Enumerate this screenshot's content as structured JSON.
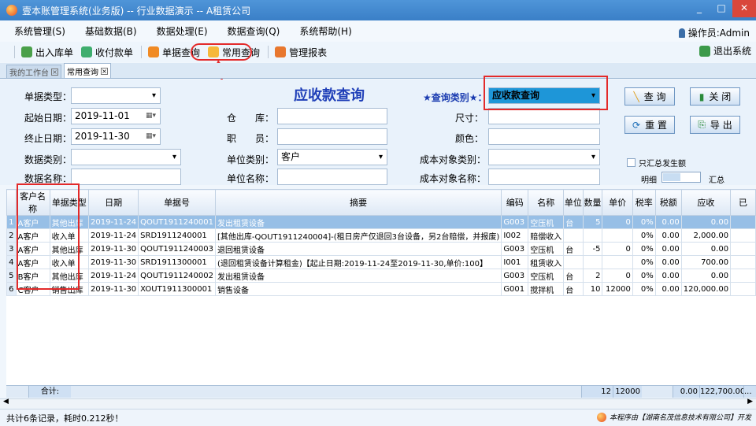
{
  "window": {
    "title": "壹本账管理系统(业务版) -- 行业数据演示 -- A租赁公司",
    "min": "_",
    "max": "□",
    "close": "✕"
  },
  "menu": [
    "系统管理(S)",
    "基础数据(B)",
    "数据处理(E)",
    "数据查询(Q)",
    "系统帮助(H)"
  ],
  "operator": "操作员:Admin",
  "toolbar": {
    "items": [
      "出入库单",
      "收付款单",
      "单据查询",
      "常用查询",
      "管理报表"
    ],
    "exit": "退出系统"
  },
  "tabs": [
    "我的工作台",
    "常用查询"
  ],
  "form": {
    "title": "应收款查询",
    "doc_type_label": "单据类型：",
    "doc_type_value": "",
    "start_label": "起始日期：",
    "start_value": "2019-11-01",
    "end_label": "终止日期：",
    "end_value": "2019-11-30",
    "data_type_label": "数据类别：",
    "data_type_value": "",
    "data_name_label": "数据名称：",
    "data_name_value": "",
    "warehouse_label": "仓　　库：",
    "warehouse_value": "",
    "staff_label": "职　　员：",
    "staff_value": "",
    "unit_type_label": "单位类别：",
    "unit_type_value": "客户",
    "unit_name_label": "单位名称：",
    "unit_name_value": "",
    "query_type_label": "★查询类别★：",
    "query_type_value": "应收款查询",
    "size_label": "尺寸：",
    "size_value": "",
    "color_label": "颜色：",
    "color_value": "",
    "cost_type_label": "成本对象类别：",
    "cost_type_value": "",
    "cost_name_label": "成本对象名称：",
    "cost_name_value": "",
    "btn_query": "查 询",
    "btn_close": "关 闭",
    "btn_reset": "重 置",
    "btn_export": "导 出",
    "summary_only": "只汇总发生额",
    "detail_label": "明细",
    "summary_label": "汇总"
  },
  "table": {
    "headers": [
      "客户名称",
      "单据类型",
      "日期",
      "单据号",
      "摘要",
      "编码",
      "名称",
      "单位",
      "数量",
      "单价",
      "税率",
      "税额",
      "应收",
      "已"
    ],
    "rows": [
      [
        "1",
        "A客户",
        "其他出库",
        "2019-11-24",
        "QOUT1911240001",
        "发出租赁设备",
        "G003",
        "空压机",
        "台",
        "5",
        "0",
        "0%",
        "0.00",
        "0.00"
      ],
      [
        "2",
        "A客户",
        "收入单",
        "2019-11-24",
        "SRD1911240001",
        "[其他出库-QOUT1911240004]-(租日房产仅退回3台设备，另2台赔偿，并报废)",
        "I002",
        "赔偿收入",
        "",
        "",
        "",
        "0%",
        "0.00",
        "2,000.00"
      ],
      [
        "3",
        "A客户",
        "其他出库",
        "2019-11-30",
        "QOUT1911240003",
        "退回租赁设备",
        "G003",
        "空压机",
        "台",
        "-5",
        "0",
        "0%",
        "0.00",
        "0.00"
      ],
      [
        "4",
        "A客户",
        "收入单",
        "2019-11-30",
        "SRD1911300001",
        "(退回租赁设备计算租金)【起止日期:2019-11-24至2019-11-30,单价:100】",
        "I001",
        "租赁收入",
        "",
        "",
        "",
        "0%",
        "0.00",
        "700.00"
      ],
      [
        "5",
        "B客户",
        "其他出库",
        "2019-11-24",
        "QOUT1911240002",
        "发出租赁设备",
        "G003",
        "空压机",
        "台",
        "2",
        "0",
        "0%",
        "0.00",
        "0.00"
      ],
      [
        "6",
        "C客户",
        "销售出库",
        "2019-11-30",
        "XOUT1911300001",
        "销售设备",
        "G001",
        "搅拌机",
        "台",
        "10",
        "12000",
        "0%",
        "0.00",
        "120,000.00"
      ]
    ],
    "footer": {
      "label": "合计:",
      "qty": "12",
      "price": "12000",
      "tax": "0.00",
      "receivable": "122,700.00",
      "more": "..."
    }
  },
  "status": {
    "text": "共计6条记录，耗时0.212秒！",
    "credit": "本程序由【湖南名茂信息技术有限公司】开发"
  }
}
